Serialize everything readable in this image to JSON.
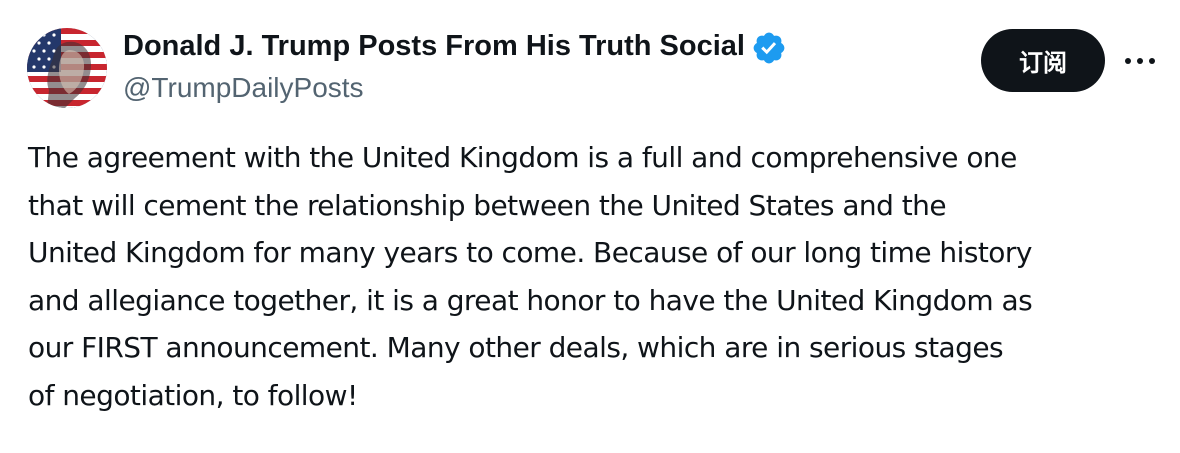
{
  "author": {
    "display_name": "Donald J. Trump Posts From His Truth Social",
    "handle": "@TrumpDailyPosts",
    "verified": true,
    "verified_color": "#1d9bf0"
  },
  "actions": {
    "subscribe_label": "订阅",
    "more_icon": "more-horizontal-icon"
  },
  "post": {
    "lines": [
      "The agreement with the United Kingdom is a full and comprehensive one",
      "that will cement the relationship between the United States and the",
      "United Kingdom for many years to come. Because of our long time history",
      "and allegiance together, it is a great honor to have the United Kingdom as",
      "our FIRST announcement. Many other deals, which are in serious stages",
      "of negotiation, to follow!"
    ]
  },
  "colors": {
    "text_primary": "#0f1419",
    "text_secondary": "#536471",
    "button_bg": "#0f1419",
    "button_text": "#ffffff"
  }
}
